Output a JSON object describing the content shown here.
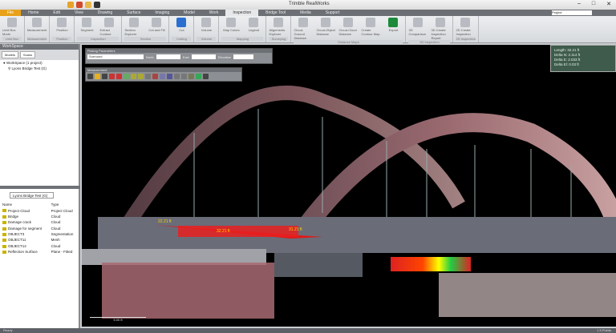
{
  "app": {
    "title": "Trimble RealWorks",
    "window_controls": [
      "–",
      "□",
      "✕"
    ],
    "workspace_label": "Project"
  },
  "tabs": [
    "File",
    "Home",
    "Edit",
    "View",
    "Drawing",
    "Surface",
    "Imaging",
    "Model",
    "Work",
    "Inspection",
    "Bridge Tool",
    "Media",
    "Support"
  ],
  "active_tab": "Inspection",
  "ribbon": [
    {
      "label": "Limit Box",
      "buttons": [
        "Limit Box Mode"
      ]
    },
    {
      "label": "Measurement",
      "buttons": [
        "Measurement"
      ]
    },
    {
      "label": "Position",
      "buttons": [
        "Position"
      ]
    },
    {
      "label": "Inspection",
      "buttons": [
        "Segment",
        "Extract Contour"
      ]
    },
    {
      "label": "Section",
      "buttons": [
        "Section Explorer",
        "Cut and Fill"
      ]
    },
    {
      "label": "Cutting",
      "buttons": [
        "Cut"
      ]
    },
    {
      "label": "Volume",
      "buttons": [
        "Volume"
      ]
    },
    {
      "label": "Mapping",
      "buttons": [
        "Map Colors",
        "Legend"
      ]
    },
    {
      "label": "Surveying",
      "buttons": [
        "Alignments Explorer"
      ]
    },
    {
      "label": "Distance Maps",
      "buttons": [
        "Cloud-Ground Distance",
        "Cloud-Object Distance",
        "Cloud-Cloud Distance",
        "Create Contour Map",
        "Export"
      ]
    },
    {
      "label": "3D Inspection",
      "buttons": [
        "3D Comparison",
        "3D Create Inspection Report"
      ]
    },
    {
      "label": "2D Inspection",
      "buttons": [
        "2D Create Inspection"
      ]
    }
  ],
  "left": {
    "header": "WorkSpace",
    "tabs": [
      "Models",
      "Scans"
    ],
    "tree": [
      "WorkSpace (1 project)",
      "Lyons Bridge Test (G)"
    ],
    "project_select": "Lyons Bridge Test (G)",
    "columns": [
      "Name",
      "Type"
    ],
    "rows": [
      {
        "name": "Project Cloud",
        "type": "Project Cloud"
      },
      {
        "name": "Bridge",
        "type": "Cloud"
      },
      {
        "name": "Damage crack",
        "type": "Cloud"
      },
      {
        "name": "Damage for segment",
        "type": "Cloud"
      },
      {
        "name": "OBJECT3",
        "type": "Segmentation"
      },
      {
        "name": "OBJECT11",
        "type": "Mesh"
      },
      {
        "name": "OBJECT14",
        "type": "Cloud"
      },
      {
        "name": "Reflection Surface",
        "type": "Plane - Fitted"
      }
    ]
  },
  "picking": {
    "header": "Picking Parameters",
    "mode": "Surround",
    "north": "North",
    "east": "East",
    "elev": "Elevation"
  },
  "measurement": {
    "header": "Measurement"
  },
  "info": [
    "Length: 32.21 ft",
    "Delta N: 2.114 ft",
    "Delta E: 2.033 ft",
    "Delta El: 0.03 ft"
  ],
  "labels": [
    "22.21 ft",
    "32.21 ft",
    "31.21 ft"
  ],
  "scale": "5.00 ft",
  "status": {
    "left": "Ready",
    "right": "1.5 Points"
  },
  "colors": {
    "accent": "#e8a21a",
    "panel": "#6c6f74",
    "info_bg": "#3e5b4c"
  }
}
